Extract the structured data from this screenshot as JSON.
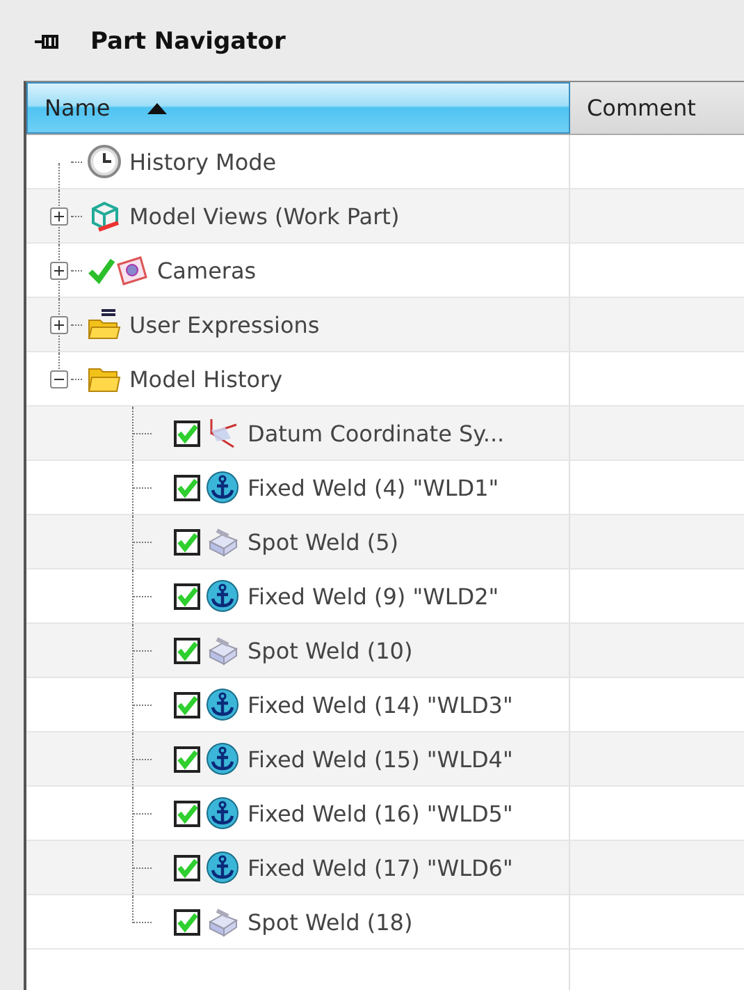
{
  "panel": {
    "title": "Part Navigator"
  },
  "columns": [
    {
      "label": "Name",
      "sorted": true
    },
    {
      "label": "Comment",
      "sorted": false
    }
  ],
  "tree": [
    {
      "label": "History Mode",
      "kind": "clock",
      "visible": false
    },
    {
      "label": "Model Views (Work Part)",
      "kind": "views",
      "expanded": false,
      "visible": false
    },
    {
      "label": "Cameras",
      "kind": "cameras",
      "expanded": false,
      "visible": true
    },
    {
      "label": "User Expressions",
      "kind": "expressions",
      "expanded": false,
      "visible": false
    },
    {
      "label": "Model History",
      "kind": "folder",
      "expanded": true,
      "visible": false,
      "children": [
        {
          "label": "Datum Coordinate Sy...",
          "kind": "datum",
          "checked": true
        },
        {
          "label": "Fixed Weld (4) \"WLD1\"",
          "kind": "anchor",
          "checked": true
        },
        {
          "label": "Spot Weld (5)",
          "kind": "spot",
          "checked": true
        },
        {
          "label": "Fixed Weld (9) \"WLD2\"",
          "kind": "anchor",
          "checked": true
        },
        {
          "label": "Spot Weld (10)",
          "kind": "spot",
          "checked": true
        },
        {
          "label": "Fixed Weld (14) \"WLD3\"",
          "kind": "anchor",
          "checked": true
        },
        {
          "label": "Fixed Weld (15) \"WLD4\"",
          "kind": "anchor",
          "checked": true
        },
        {
          "label": "Fixed Weld (16) \"WLD5\"",
          "kind": "anchor",
          "checked": true
        },
        {
          "label": "Fixed Weld (17) \"WLD6\"",
          "kind": "anchor",
          "checked": true
        },
        {
          "label": "Spot Weld (18)",
          "kind": "spot",
          "checked": true
        }
      ]
    }
  ]
}
